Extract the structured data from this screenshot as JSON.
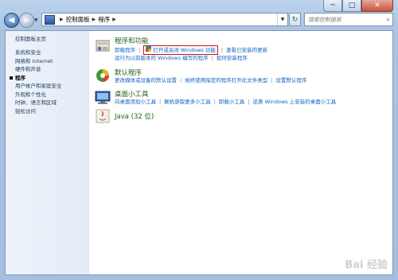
{
  "window": {
    "min": "─",
    "max": "□",
    "close": "✕"
  },
  "nav": {
    "back_glyph": "◀",
    "forward_glyph": "▶",
    "history_glyph": "▼",
    "crumb_sep": "▶",
    "breadcrumb": [
      "控制面板",
      "程序"
    ],
    "dropdown_glyph": "▼",
    "refresh_glyph": "↻",
    "search_placeholder": "搜索控制面板",
    "search_glyph": "⌕"
  },
  "sidebar": {
    "home": "控制面板主页",
    "items": [
      {
        "label": "系统和安全",
        "current": false
      },
      {
        "label": "网络和 Internet",
        "current": false
      },
      {
        "label": "硬件和声音",
        "current": false
      },
      {
        "label": "程序",
        "current": true
      },
      {
        "label": "用户帐户和家庭安全",
        "current": false
      },
      {
        "label": "外观和个性化",
        "current": false
      },
      {
        "label": "时钟、语言和区域",
        "current": false
      },
      {
        "label": "轻松访问",
        "current": false
      }
    ]
  },
  "sections": [
    {
      "title": "程序和功能",
      "icon": "programs-features-icon",
      "row1": [
        "卸载程序",
        "打开或关闭 Windows 功能",
        "查看已安装的更新"
      ],
      "row2": [
        "运行为以前版本的 Windows 编写的程序",
        "如何安装程序"
      ]
    },
    {
      "title": "默认程序",
      "icon": "default-programs-icon",
      "row1": [
        "更改媒体或设备的默认设置",
        "始终使用指定的程序打开此文件类型",
        "设置默认程序"
      ]
    },
    {
      "title": "桌面小工具",
      "icon": "desktop-gadgets-icon",
      "row1": [
        "向桌面添加小工具",
        "联机获取更多小工具",
        "卸载小工具",
        "还原 Windows 上安装的桌面小工具"
      ]
    },
    {
      "title": "Java (32 位)",
      "icon": "java-icon"
    }
  ],
  "watermark": "Bai 经验"
}
